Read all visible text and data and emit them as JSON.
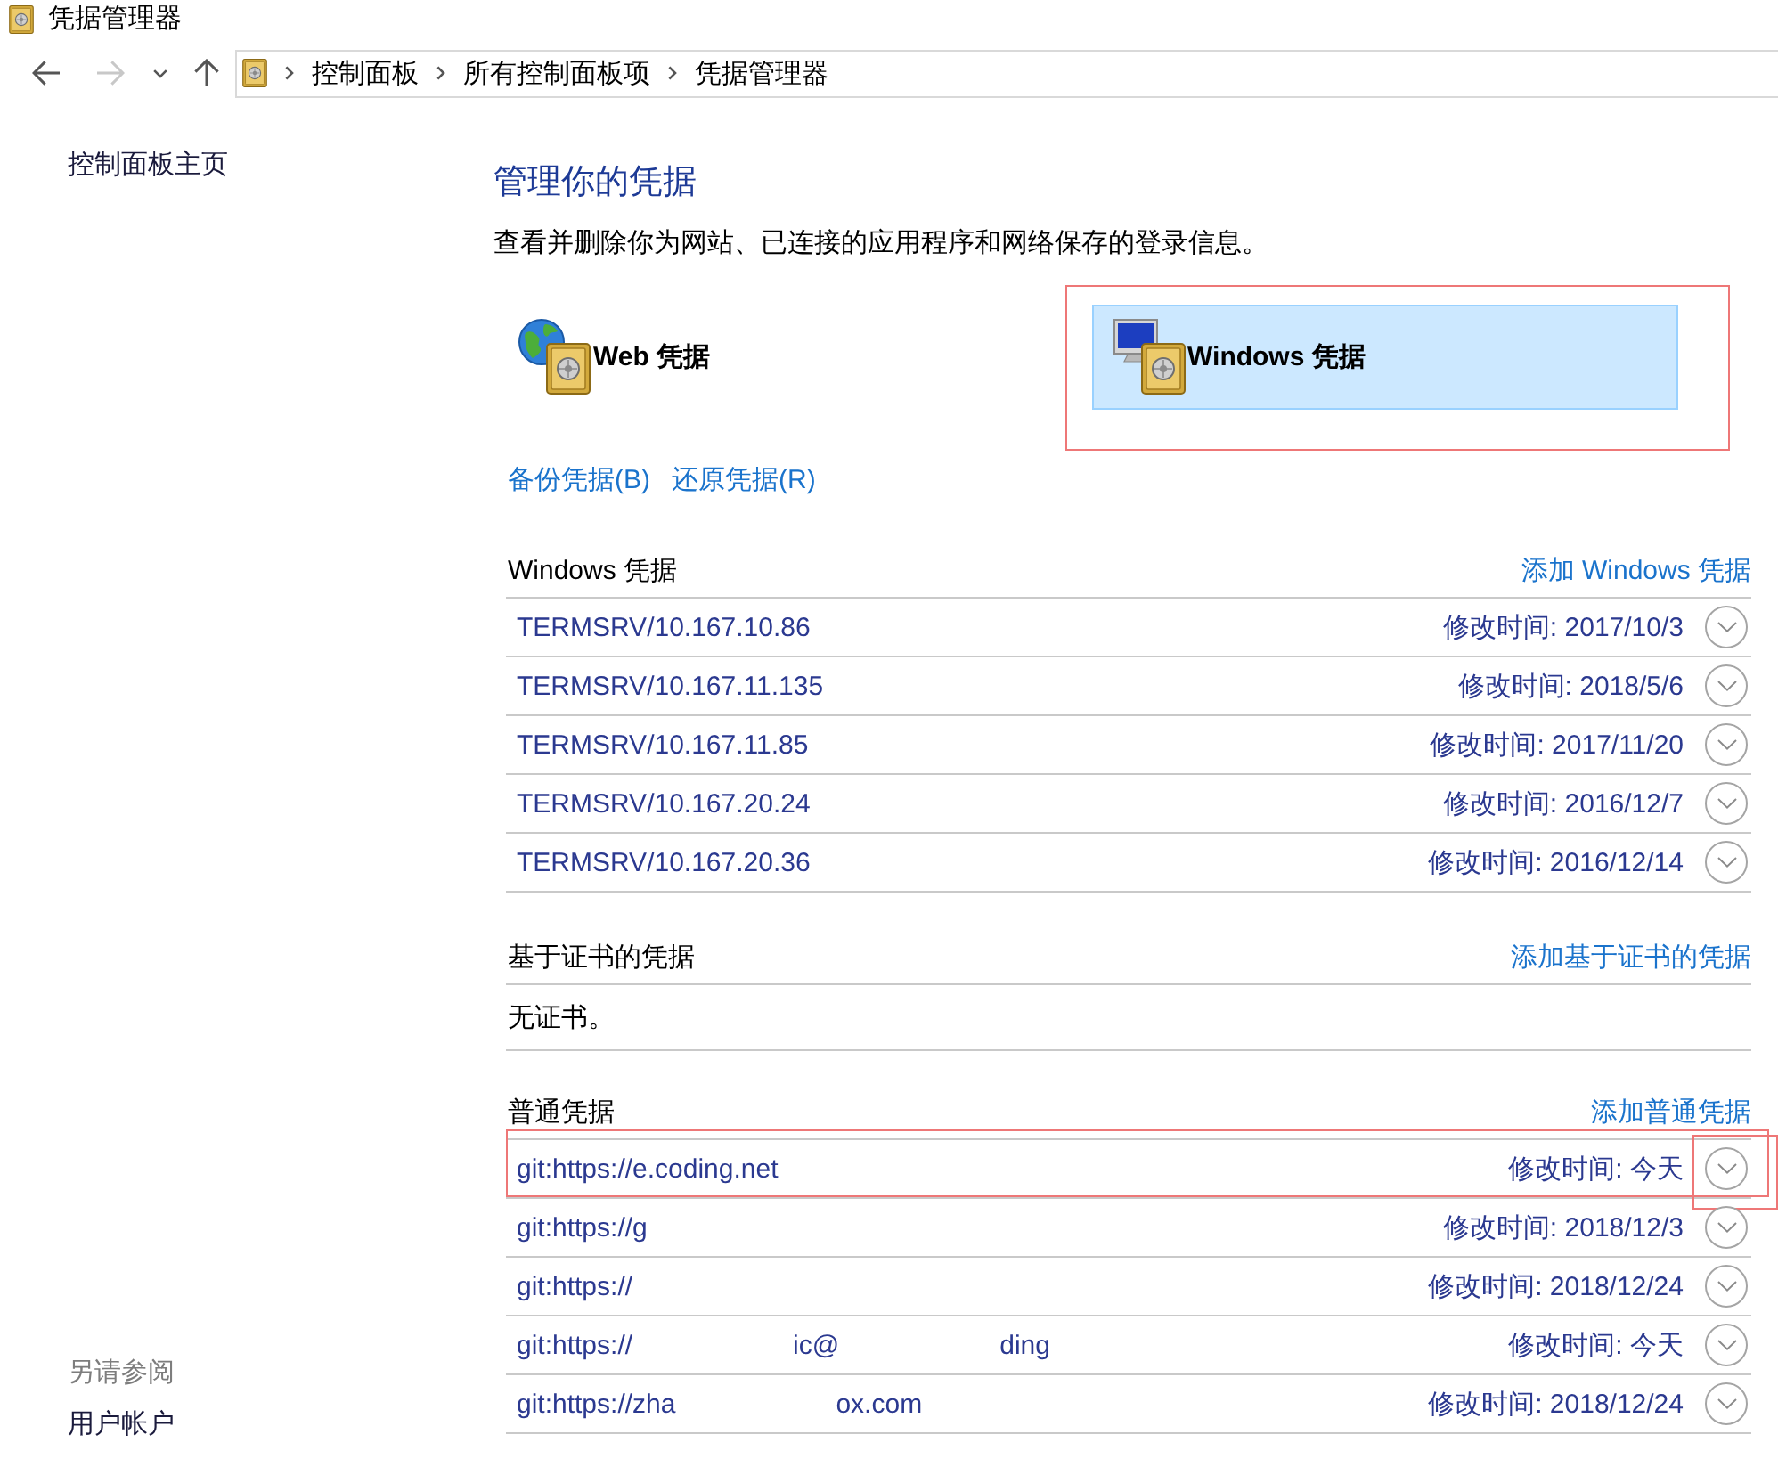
{
  "window": {
    "title": "凭据管理器"
  },
  "nav": {
    "buttons": [
      {
        "kind": "back",
        "disabled": false
      },
      {
        "kind": "forward",
        "disabled": true
      },
      {
        "kind": "recent",
        "disabled": false
      },
      {
        "kind": "up",
        "disabled": false
      }
    ],
    "breadcrumbs": [
      "控制面板",
      "所有控制面板项",
      "凭据管理器"
    ]
  },
  "sidebar": {
    "home_link": "控制面板主页",
    "see_also_title": "另请参阅",
    "see_also_links": [
      "用户帐户"
    ]
  },
  "main": {
    "title": "管理你的凭据",
    "description": "查看并删除你为网站、已连接的应用程序和网络保存的登录信息。",
    "vaults": [
      {
        "kind": "web",
        "label": "Web 凭据",
        "selected": false,
        "highlighted": false
      },
      {
        "kind": "windows",
        "label": "Windows 凭据",
        "selected": true,
        "highlighted": true
      }
    ],
    "actions": [
      "备份凭据(B)",
      "还原凭据(R)"
    ],
    "sections": [
      {
        "title": "Windows 凭据",
        "add_link": "添加 Windows 凭据",
        "items": [
          {
            "name": "TERMSRV/10.167.10.86",
            "modified": "修改时间: 2017/10/3",
            "highlighted": false
          },
          {
            "name": "TERMSRV/10.167.11.135",
            "modified": "修改时间: 2018/5/6",
            "highlighted": false
          },
          {
            "name": "TERMSRV/10.167.11.85",
            "modified": "修改时间: 2017/11/20",
            "highlighted": false
          },
          {
            "name": "TERMSRV/10.167.20.24",
            "modified": "修改时间: 2016/12/7",
            "highlighted": false
          },
          {
            "name": "TERMSRV/10.167.20.36",
            "modified": "修改时间: 2016/12/14",
            "highlighted": false
          }
        ]
      },
      {
        "title": "基于证书的凭据",
        "add_link": "添加基于证书的凭据",
        "empty_text": "无证书。"
      },
      {
        "title": "普通凭据",
        "add_link": "添加普通凭据",
        "items": [
          {
            "name": "git:https://e.coding.net",
            "modified": "修改时间: 今天",
            "highlighted": true
          },
          {
            "name": "git:https://g",
            "modified": "修改时间: 2018/12/3",
            "highlighted": false
          },
          {
            "name": "git:https://",
            "modified": "修改时间: 2018/12/24",
            "highlighted": false
          },
          {
            "name": "git:https://",
            "fragments": [
              "ic@",
              "ding"
            ],
            "modified": "修改时间: 今天",
            "highlighted": false
          },
          {
            "name": "git:https://zha",
            "fragments": [
              "ox.com"
            ],
            "modified": "修改时间: 2018/12/24",
            "highlighted": false
          }
        ]
      }
    ]
  }
}
